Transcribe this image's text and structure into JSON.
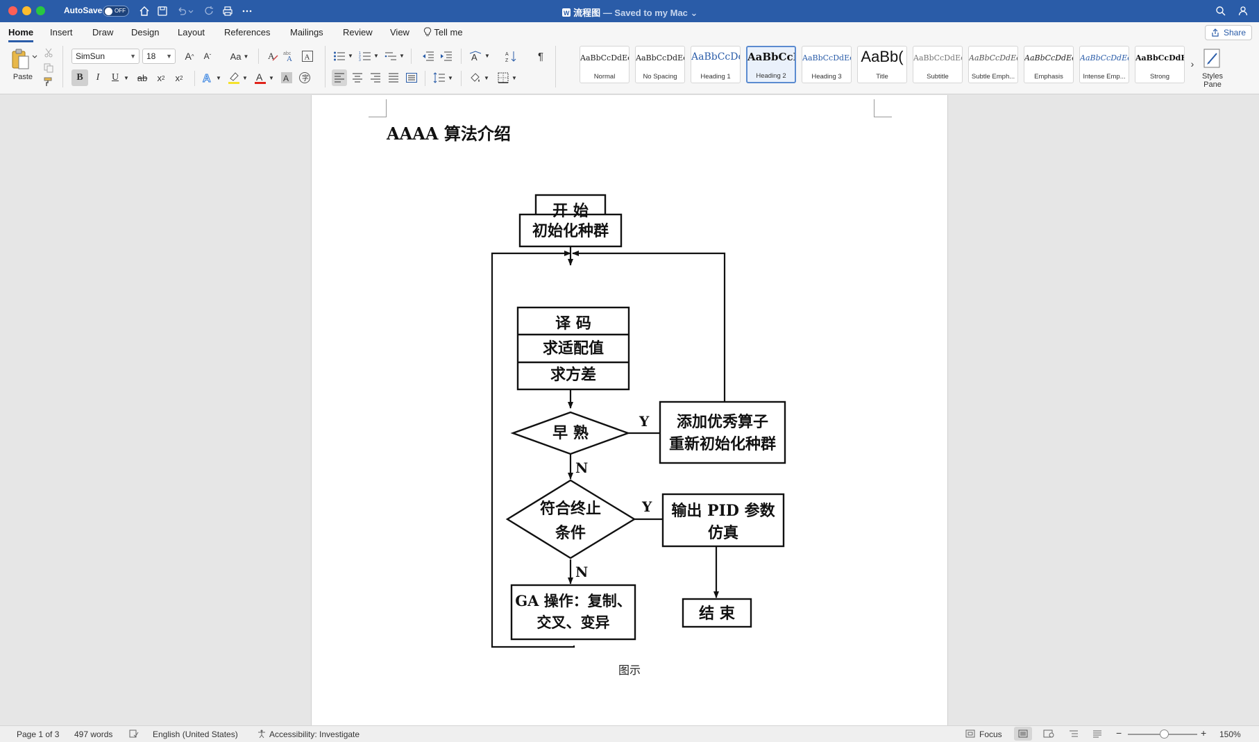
{
  "titlebar": {
    "autosave_label": "AutoSave",
    "autosave_state": "OFF",
    "doc_name": "流程图",
    "doc_status": "— Saved to my Mac",
    "colors": {
      "bar": "#2a5ca8"
    }
  },
  "ribbon": {
    "tabs": [
      "Home",
      "Insert",
      "Draw",
      "Design",
      "Layout",
      "References",
      "Mailings",
      "Review",
      "View",
      "Tell me"
    ],
    "active_tab": "Home",
    "share_label": "Share",
    "paste_label": "Paste",
    "font_name": "SimSun",
    "font_size": "18",
    "case_label": "Aa",
    "styles": [
      {
        "preview": "AaBbCcDdEe",
        "label": "Normal"
      },
      {
        "preview": "AaBbCcDdEe",
        "label": "No Spacing"
      },
      {
        "preview": "AaBbCcDc",
        "label": "Heading 1"
      },
      {
        "preview": "AaBbCcI",
        "label": "Heading 2",
        "active": true
      },
      {
        "preview": "AaBbCcDdEe",
        "label": "Heading 3"
      },
      {
        "preview": "AaBb(",
        "label": "Title"
      },
      {
        "preview": "AaBbCcDdEe",
        "label": "Subtitle"
      },
      {
        "preview": "AaBbCcDdEe",
        "label": "Subtle Emph..."
      },
      {
        "preview": "AaBbCcDdEe",
        "label": "Emphasis"
      },
      {
        "preview": "AaBbCcDdEe",
        "label": "Intense Emp..."
      },
      {
        "preview": "AaBbCcDdEe",
        "label": "Strong"
      }
    ],
    "styles_pane_label_1": "Styles",
    "styles_pane_label_2": "Pane"
  },
  "document": {
    "heading": "AAAA 算法介绍",
    "caption": "图示",
    "flowchart": {
      "start": "开 始",
      "init": "初始化种群",
      "decode": "译 码",
      "fitness": "求适配值",
      "variance": "求方差",
      "premature": "早 熟",
      "add_line1": "添加优秀算子",
      "add_line2": "重新初始化种群",
      "terminate_line1": "符合终止",
      "terminate_line2": "条件",
      "output_line1": "输出 PID 参数",
      "output_line2": "仿真",
      "ga_line1": "GA 操作：复制、",
      "ga_line2": "交叉、变异",
      "end": "结 束",
      "yes": "Y",
      "no": "N"
    }
  },
  "statusbar": {
    "page": "Page 1 of 3",
    "words": "497 words",
    "language": "English (United States)",
    "accessibility": "Accessibility: Investigate",
    "focus": "Focus",
    "zoom": "150%"
  }
}
